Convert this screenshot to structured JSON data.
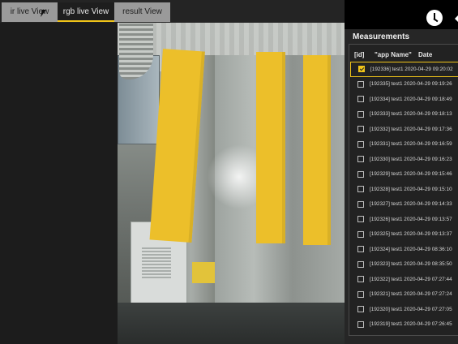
{
  "tabs": [
    {
      "label": "ir live View"
    },
    {
      "label": "rgb live View"
    },
    {
      "label": "result View"
    }
  ],
  "panel": {
    "title": "Measurements",
    "headers": {
      "id": "[id]",
      "app": "\"app Name\"",
      "date": "Date"
    },
    "rows": [
      {
        "text": "[192336] test1 2020-04-29 09:20:02",
        "checked": true
      },
      {
        "text": "[192335] test1 2020-04-29 09:19:26",
        "checked": false
      },
      {
        "text": "[192334] test1 2020-04-29 09:18:49",
        "checked": false
      },
      {
        "text": "[192333] test1 2020-04-29 09:18:13",
        "checked": false
      },
      {
        "text": "[192332] test1 2020-04-29 09:17:36",
        "checked": false
      },
      {
        "text": "[192331] test1 2020-04-29 09:16:59",
        "checked": false
      },
      {
        "text": "[192330] test1 2020-04-29 09:16:23",
        "checked": false
      },
      {
        "text": "[192329] test1 2020-04-29 09:15:46",
        "checked": false
      },
      {
        "text": "[192328] test1 2020-04-29 09:15:10",
        "checked": false
      },
      {
        "text": "[192327] test1 2020-04-29 09:14:33",
        "checked": false
      },
      {
        "text": "[192326] test1 2020-04-29 09:13:57",
        "checked": false
      },
      {
        "text": "[192325] test1 2020-04-29 09:13:37",
        "checked": false
      },
      {
        "text": "[192324] test1 2020-04-29 08:36:10",
        "checked": false
      },
      {
        "text": "[192323] test1 2020-04-29 08:35:50",
        "checked": false
      },
      {
        "text": "[192322] test1 2020-04-29 07:27:44",
        "checked": false
      },
      {
        "text": "[192321] test1 2020-04-29 07:27:24",
        "checked": false
      },
      {
        "text": "[192320] test1 2020-04-29 07:27:05",
        "checked": false
      },
      {
        "text": "[192319] test1 2020-04-29 07:26:45",
        "checked": false
      }
    ]
  },
  "icons": {
    "clock": "clock-icon",
    "corner": "chevron-left-icon"
  },
  "colors": {
    "accent": "#f0c419",
    "background": "#1b1b1b"
  }
}
